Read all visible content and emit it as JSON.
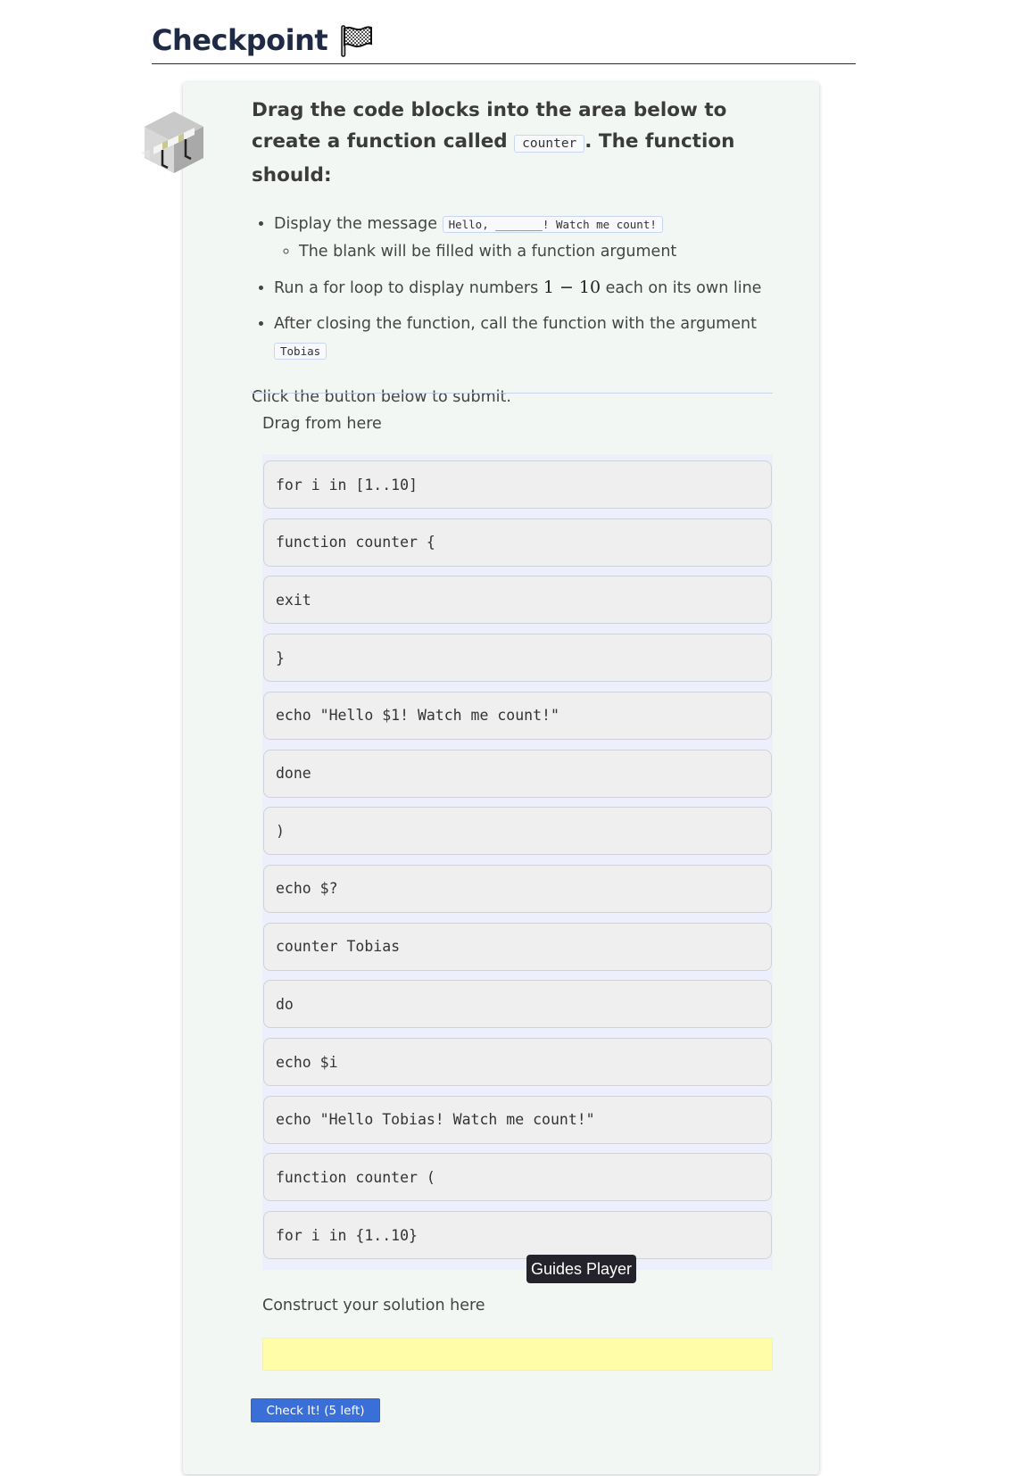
{
  "header": {
    "title": "Checkpoint",
    "title_icon": "checkered-flag-icon"
  },
  "card": {
    "side_icon": "hurdle-icon",
    "prompt_part1": "Drag the code blocks into the area below to create a function called",
    "prompt_code": "counter",
    "prompt_part2": ". The function should:",
    "requirements": [
      {
        "text_before": "Display the message",
        "code": "Hello, _______! Watch me count!",
        "sub_items": [
          "The blank will be filled with a function argument"
        ]
      },
      {
        "text_before": "Run a for loop to display numbers",
        "math": "1 − 10",
        "text_after": "each on its own line"
      },
      {
        "text_before": "After closing the function, call the function with the argument",
        "code": "Tobias"
      }
    ],
    "submit_note": "Click the button below to submit."
  },
  "source": {
    "label": "Drag from here",
    "blocks": [
      "for i in [1..10]",
      "function counter {",
      "exit",
      "}",
      "echo \"Hello $1! Watch me count!\"",
      "done",
      ")",
      "echo $?",
      "counter Tobias",
      "do",
      "echo $i",
      "echo \"Hello Tobias! Watch me count!\"",
      "function counter (",
      "for i in {1..10}"
    ]
  },
  "tooltip": {
    "text": "Guides Player"
  },
  "solution": {
    "label": "Construct your solution here",
    "blocks": []
  },
  "check_button": {
    "label": "Check It! (5 left)"
  },
  "colors": {
    "button": "#3a6fd8",
    "solution_area": "#fffda8",
    "source_area": "#eeeffc",
    "card_bg": "#f3f7f4"
  }
}
